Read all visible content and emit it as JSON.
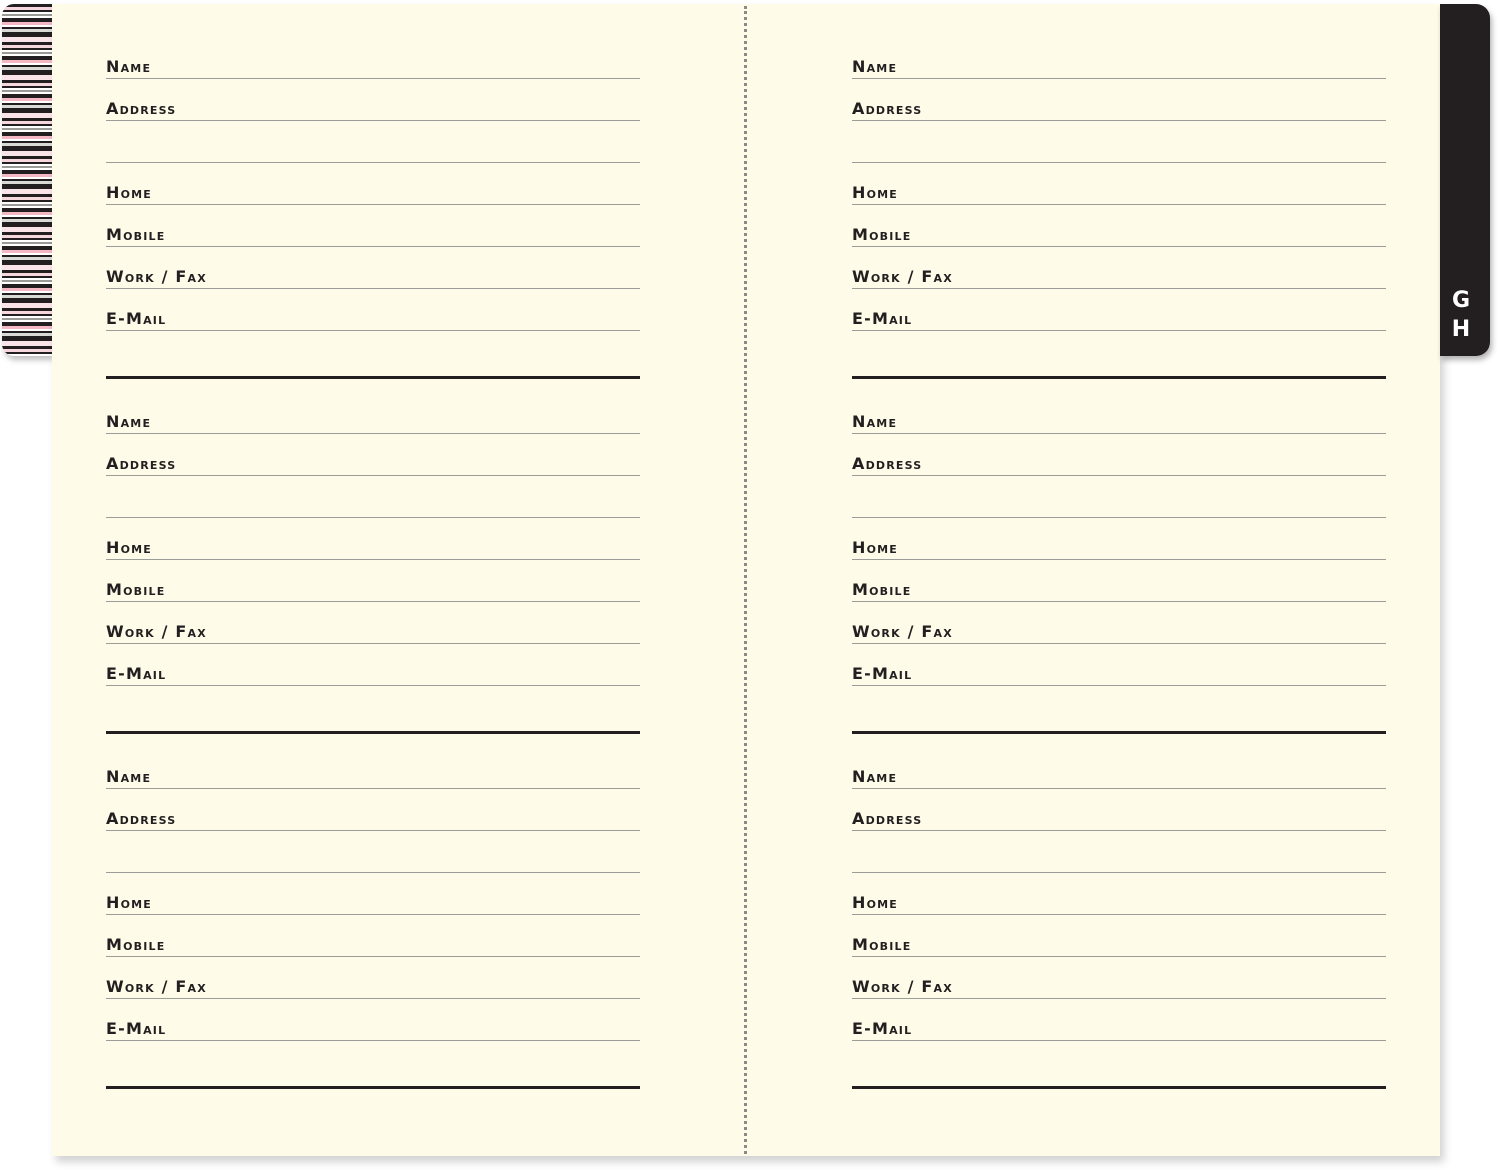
{
  "labels": {
    "name": "Name",
    "address": "Address",
    "home": "Home",
    "mobile": "Mobile",
    "work_fax": "Work / Fax",
    "email": "E-Mail"
  },
  "index_tab": {
    "letters": [
      "G",
      "H"
    ]
  },
  "colors": {
    "page": "#fefbe9",
    "ink": "#231f20",
    "rule": "#9c9c98",
    "accent_pink": "#f3b8c4"
  }
}
